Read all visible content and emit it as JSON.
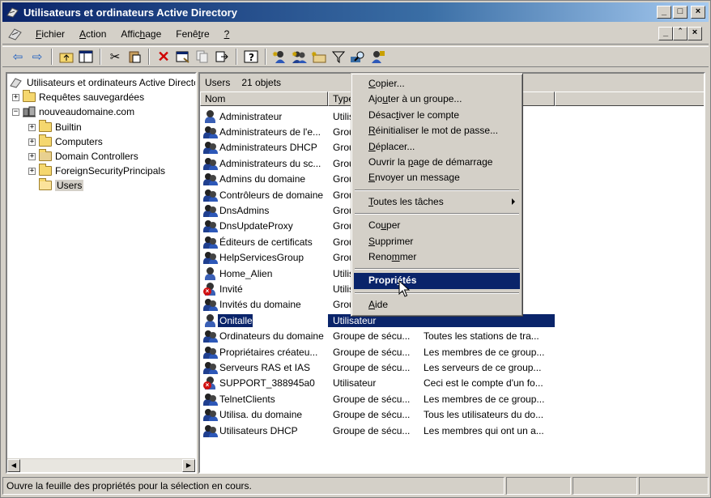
{
  "window": {
    "title": "Utilisateurs et ordinateurs Active Directory",
    "controls": [
      "_",
      "□",
      "×"
    ]
  },
  "menubar": {
    "items": [
      {
        "pre": "",
        "u": "F",
        "post": "ichier"
      },
      {
        "pre": "",
        "u": "A",
        "post": "ction"
      },
      {
        "pre": "Affic",
        "u": "h",
        "post": "age"
      },
      {
        "pre": "Fenê",
        "u": "t",
        "post": "re"
      },
      {
        "pre": "",
        "u": "?",
        "post": ""
      }
    ],
    "mdi_controls": [
      "_",
      "ˆ",
      "×"
    ]
  },
  "toolbar": {
    "icons": [
      "back-arrow-icon",
      "forward-arrow-icon",
      "up-folder-icon",
      "show-tree-icon",
      "cut-icon",
      "paste-icon",
      "delete-icon",
      "properties-icon",
      "copy-icon",
      "export-icon",
      "help-icon",
      "new-user-icon",
      "new-group-icon",
      "new-ou-icon",
      "filter-icon",
      "find-icon",
      "add-to-group-icon"
    ]
  },
  "tree": {
    "root": "Utilisateurs et ordinateurs Active Directo",
    "saved_queries": "Requêtes sauvegardées",
    "domain": "nouveaudomaine.com",
    "children": [
      "Builtin",
      "Computers",
      "Domain Controllers",
      "ForeignSecurityPrincipals",
      "Users"
    ]
  },
  "list": {
    "header_name": "Users",
    "header_count": "21 objets",
    "columns": [
      "Nom",
      "Type",
      "Description"
    ],
    "rows": [
      {
        "name": "Administrateur",
        "type": "Utilis",
        "desc": "adm...",
        "kind": "user"
      },
      {
        "name": "Administrateurs de l'e...",
        "type": "Grou",
        "desc": "és ...",
        "kind": "group"
      },
      {
        "name": "Administrateurs DHCP",
        "type": "Grou",
        "desc": "n a...",
        "kind": "group"
      },
      {
        "name": "Administrateurs du sc...",
        "type": "Grou",
        "desc": "és ...",
        "kind": "group"
      },
      {
        "name": "Admins du domaine",
        "type": "Grou",
        "desc": "és ...",
        "kind": "group"
      },
      {
        "name": "Contrôleurs de domaine",
        "type": "Grou",
        "desc": "e do...",
        "kind": "group"
      },
      {
        "name": "DnsAdmins",
        "type": "Grou",
        "desc": "teu...",
        "kind": "group"
      },
      {
        "name": "DnsUpdateProxy",
        "type": "Grou",
        "desc": "t a...",
        "kind": "group"
      },
      {
        "name": "Éditeurs de certificats",
        "type": "Grou",
        "desc": "up...",
        "kind": "group"
      },
      {
        "name": "HelpServicesGroup",
        "type": "Grou",
        "desc": "d'ai...",
        "kind": "group"
      },
      {
        "name": "Home_Alien",
        "type": "Utilis",
        "desc": "tio...",
        "kind": "user"
      },
      {
        "name": "Invité",
        "type": "Utilis",
        "desc": "vité",
        "kind": "user-disabled"
      },
      {
        "name": "Invités du domaine",
        "type": "Grou",
        "desc": "maine",
        "kind": "group"
      },
      {
        "name": "Onitalle",
        "type": "Utilisateur",
        "desc": "",
        "kind": "user",
        "selected": true
      },
      {
        "name": "Ordinateurs du domaine",
        "type": "Groupe de sécu...",
        "desc": "Toutes les stations de tra...",
        "kind": "group"
      },
      {
        "name": "Propriétaires créateu...",
        "type": "Groupe de sécu...",
        "desc": "Les membres de ce group...",
        "kind": "group"
      },
      {
        "name": "Serveurs RAS et IAS",
        "type": "Groupe de sécu...",
        "desc": "Les serveurs de ce group...",
        "kind": "group"
      },
      {
        "name": "SUPPORT_388945a0",
        "type": "Utilisateur",
        "desc": "Ceci est le compte d'un fo...",
        "kind": "user-disabled"
      },
      {
        "name": "TelnetClients",
        "type": "Groupe de sécu...",
        "desc": "Les membres de ce group...",
        "kind": "group"
      },
      {
        "name": "Utilisa. du domaine",
        "type": "Groupe de sécu...",
        "desc": "Tous les utilisateurs du do...",
        "kind": "group"
      },
      {
        "name": "Utilisateurs DHCP",
        "type": "Groupe de sécu...",
        "desc": "Les membres qui ont un a...",
        "kind": "group"
      }
    ]
  },
  "context_menu": {
    "groups": [
      [
        {
          "id": "copy",
          "pre": "",
          "u": "C",
          "post": "opier..."
        },
        {
          "id": "add-to-group",
          "pre": "Ajo",
          "u": "u",
          "post": "ter à un groupe..."
        },
        {
          "id": "disable-account",
          "pre": "Désac",
          "u": "t",
          "post": "iver le compte"
        },
        {
          "id": "reset-password",
          "pre": "",
          "u": "R",
          "post": "éinitialiser le mot de passe..."
        },
        {
          "id": "move",
          "pre": "",
          "u": "D",
          "post": "éplacer..."
        },
        {
          "id": "open-home-page",
          "pre": "Ouvrir la ",
          "u": "p",
          "post": "age de démarrage"
        },
        {
          "id": "send-mail",
          "pre": "",
          "u": "E",
          "post": "nvoyer un message"
        }
      ],
      [
        {
          "id": "all-tasks",
          "pre": "",
          "u": "T",
          "post": "outes les tâches",
          "submenu": true
        }
      ],
      [
        {
          "id": "cut",
          "pre": "Co",
          "u": "u",
          "post": "per"
        },
        {
          "id": "delete",
          "pre": "",
          "u": "S",
          "post": "upprimer"
        },
        {
          "id": "rename",
          "pre": "Reno",
          "u": "m",
          "post": "mer"
        }
      ],
      [
        {
          "id": "properties",
          "pre": "Propri",
          "u": "é",
          "post": "tés",
          "bold": true,
          "highlighted": true
        }
      ],
      [
        {
          "id": "help",
          "pre": "",
          "u": "A",
          "post": "ide"
        }
      ]
    ]
  },
  "statusbar": {
    "text": "Ouvre la feuille des propriétés pour la sélection en cours."
  },
  "colors": {
    "selection": "#0a246a",
    "titlebar_start": "#0a246a",
    "titlebar_end": "#a6caf0",
    "face": "#d4d0c8"
  }
}
